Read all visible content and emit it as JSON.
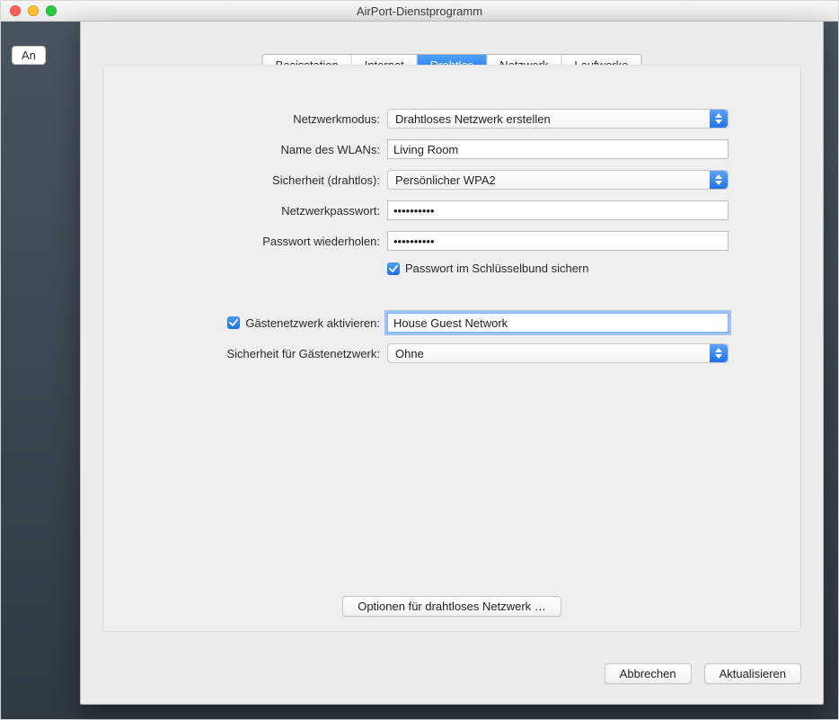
{
  "window": {
    "title": "AirPort-Dienstprogramm",
    "behind_button_partial": "An"
  },
  "tabs": [
    {
      "label": "Basisstation",
      "selected": false
    },
    {
      "label": "Internet",
      "selected": false
    },
    {
      "label": "Drahtlos",
      "selected": true
    },
    {
      "label": "Netzwerk",
      "selected": false
    },
    {
      "label": "Laufwerke",
      "selected": false
    }
  ],
  "form": {
    "network_mode": {
      "label": "Netzwerkmodus:",
      "value": "Drahtloses Netzwerk erstellen"
    },
    "wlan_name": {
      "label": "Name des WLANs:",
      "value": "Living Room"
    },
    "security": {
      "label": "Sicherheit (drahtlos):",
      "value": "Persönlicher WPA2"
    },
    "password": {
      "label": "Netzwerkpasswort:",
      "value": "••••••••••"
    },
    "password2": {
      "label": "Passwort wiederholen:",
      "value": "••••••••••"
    },
    "keychain": {
      "checked": true,
      "label": "Passwort im Schlüsselbund sichern"
    },
    "guest_enable": {
      "checked": true,
      "label": "Gästenetzwerk aktivieren:",
      "value": "House Guest Network"
    },
    "guest_security": {
      "label": "Sicherheit für Gästenetzwerk:",
      "value": "Ohne"
    },
    "options_button": "Optionen für drahtloses Netzwerk …"
  },
  "footer": {
    "cancel": "Abbrechen",
    "update": "Aktualisieren"
  },
  "icons": {
    "close": "close-icon",
    "minimize": "minimize-icon",
    "zoom": "zoom-icon",
    "select_stepper": "up-down-chevron-icon",
    "check": "checkmark-icon"
  }
}
